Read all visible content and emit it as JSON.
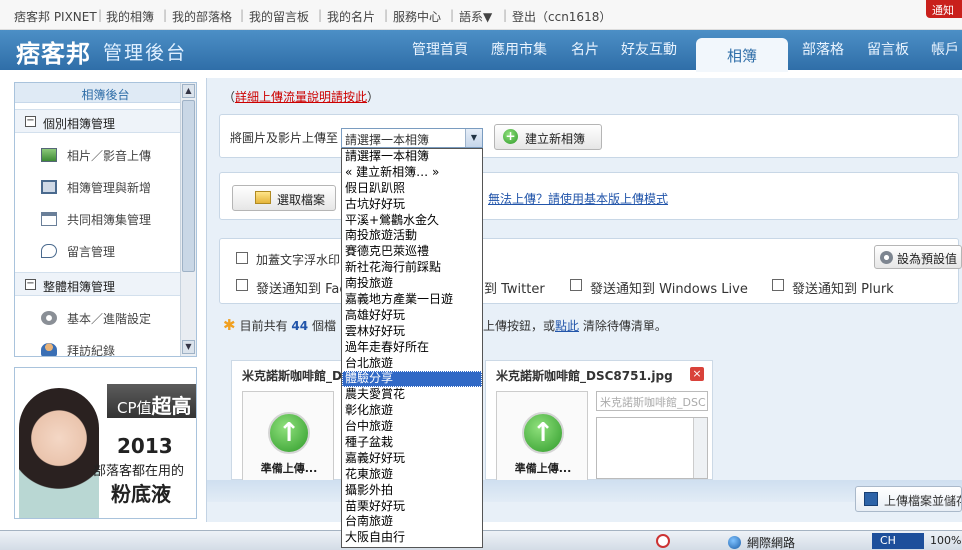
{
  "topbar": {
    "items": [
      "痞客邦 PIXNET",
      "我的相簿",
      "我的部落格",
      "我的留言板",
      "我的名片",
      "服務中心",
      "語系▼",
      "登出（ccn1618）"
    ],
    "notify": "通知"
  },
  "header": {
    "logo": "痞客邦",
    "subtitle": "管理後台",
    "nav": [
      "管理首頁",
      "應用市集",
      "名片",
      "好友互動",
      "相簿",
      "部落格",
      "留言板",
      "帳戶"
    ],
    "active": "相簿"
  },
  "sidebar": {
    "title": "相簿後台",
    "section1": "個別相簿管理",
    "items1": [
      "相片／影音上傳",
      "相簿管理與新增",
      "共同相簿集管理",
      "留言管理"
    ],
    "section2": "整體相簿管理",
    "items2": [
      "基本／進階設定",
      "拜訪紀錄"
    ]
  },
  "ad": {
    "line1_a": "CP值",
    "line1_b": "超高",
    "year": "2013",
    "line2": "部落客都在用的",
    "line3": "粉底液"
  },
  "main": {
    "traffic_prefix": "（",
    "traffic_link": "詳細上傳流量說明請按此",
    "traffic_suffix": "）",
    "upload_to_label": "將圖片及影片上傳至",
    "select_value": "請選擇一本相簿",
    "new_album_button": "建立新相簿",
    "choose_files_button": "選取檔案",
    "basic_mode_link": "無法上傳？請使用基本版上傳模式",
    "watermark_label": "加蓋文字浮水印",
    "default_button": "設為預設值",
    "notify_fb": "發送通知到 Fac",
    "notify_twitter": "到 Twitter",
    "notify_windows": "發送通知到 Windows Live",
    "notify_plurk": "發送通知到 Plurk",
    "status_prefix": "目前共有",
    "status_count": "44",
    "status_mid": "個檔",
    "status_tail": "上傳按鈕，或",
    "status_link": "點此",
    "status_end": "清除待傳清單。",
    "card1_name": "米克諾斯咖啡館_D",
    "card2_name": "米克諾斯咖啡館_DSC8751.jpg",
    "card2_input": "米克諾斯咖啡館_DSC",
    "upload_ready": "準備上傳...",
    "save_button": "上傳檔案並儲存"
  },
  "dropdown": {
    "options": [
      "請選擇一本相簿",
      "« 建立新相簿… »",
      "假日趴趴照",
      "古坑好好玩",
      "平溪+鶯鸛水金久",
      "南投旅遊活動",
      "賽德克巴萊巡禮",
      "新社花海行前踩點",
      "南投旅遊",
      "嘉義地方產業一日遊",
      "高雄好好玩",
      "雲林好好玩",
      "過年走春好所在",
      "台北旅遊",
      "體驗分享",
      "農夫愛賞花",
      "彰化旅遊",
      "台中旅遊",
      "種子盆栽",
      "嘉義好好玩",
      "花東旅遊",
      "攝影外拍",
      "苗栗好好玩",
      "台南旅遊",
      "大阪自由行"
    ],
    "selected_index": 14
  },
  "taskbar": {
    "network": "網際網路",
    "lang": "CH",
    "clock": "100%"
  }
}
